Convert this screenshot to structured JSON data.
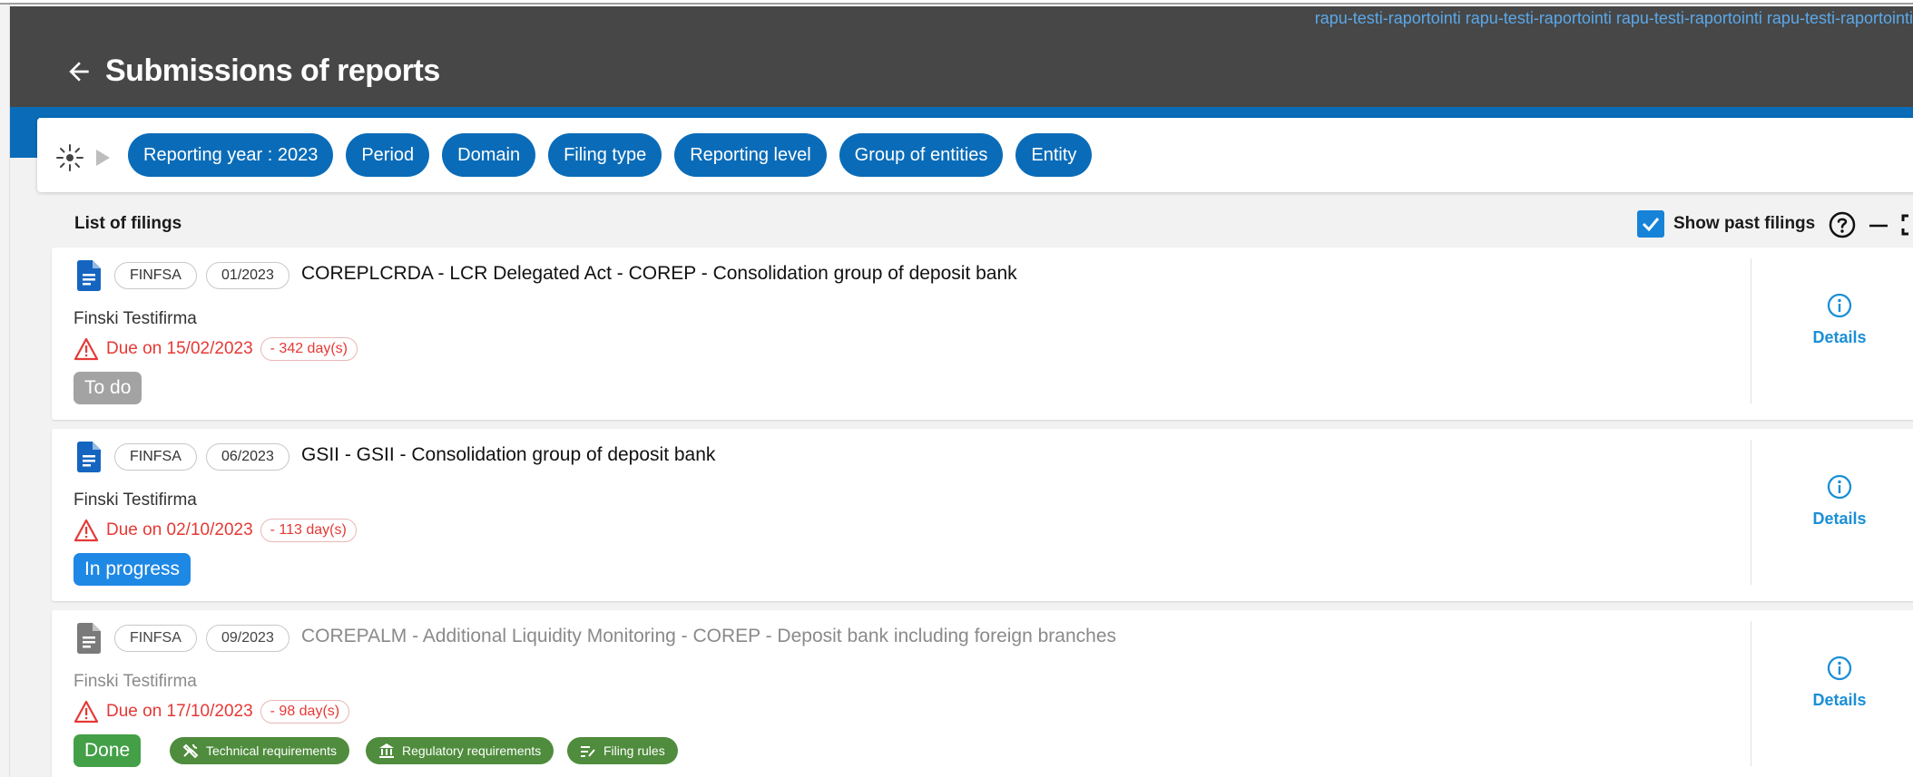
{
  "environment": {
    "label": "rapu-testi-raportointi rapu-testi-raportointi rapu-testi-raportointi rapu-testi-raportointi"
  },
  "header": {
    "back_icon": "arrow-left-icon",
    "title": "Submissions of reports"
  },
  "filters": {
    "icon": "sun-filter-icon",
    "chips": [
      {
        "label": "Reporting year : 2023"
      },
      {
        "label": "Period"
      },
      {
        "label": "Domain"
      },
      {
        "label": "Filing type"
      },
      {
        "label": "Reporting level"
      },
      {
        "label": "Group of entities"
      },
      {
        "label": "Entity"
      }
    ]
  },
  "list": {
    "title": "List of filings",
    "show_past_label": "Show past filings",
    "show_past_checked": true
  },
  "filings": [
    {
      "org": "FINFSA",
      "period": "01/2023",
      "title": "COREPLCRDA - LCR Delegated Act - COREP - Consolidation group of deposit bank",
      "entity": "Finski Testifirma",
      "due": "Due on 15/02/2023",
      "days": "- 342 day(s)",
      "status": "To do",
      "details": "Details",
      "icon_color": "#1565c0"
    },
    {
      "org": "FINFSA",
      "period": "06/2023",
      "title": "GSII - GSII - Consolidation group of deposit bank",
      "entity": "Finski Testifirma",
      "due": "Due on 02/10/2023",
      "days": "- 113 day(s)",
      "status": "In progress",
      "details": "Details",
      "icon_color": "#1565c0"
    },
    {
      "org": "FINFSA",
      "period": "09/2023",
      "title": "COREPALM - Additional Liquidity Monitoring - COREP - Deposit bank including foreign branches",
      "entity": "Finski Testifirma",
      "due": "Due on 17/10/2023",
      "days": "- 98 day(s)",
      "status": "Done",
      "details": "Details",
      "icon_color": "#7a7a7a",
      "requirements": [
        {
          "label": "Technical requirements",
          "icon": "tools-icon"
        },
        {
          "label": "Regulatory requirements",
          "icon": "bank-icon"
        },
        {
          "label": "Filing rules",
          "icon": "rules-list-icon"
        }
      ]
    }
  ],
  "colors": {
    "header_bg": "#474747",
    "brand_blue": "#0a6cb8",
    "alert_red": "#e53935",
    "done_green": "#43a047",
    "link_blue": "#1a8fd6"
  }
}
